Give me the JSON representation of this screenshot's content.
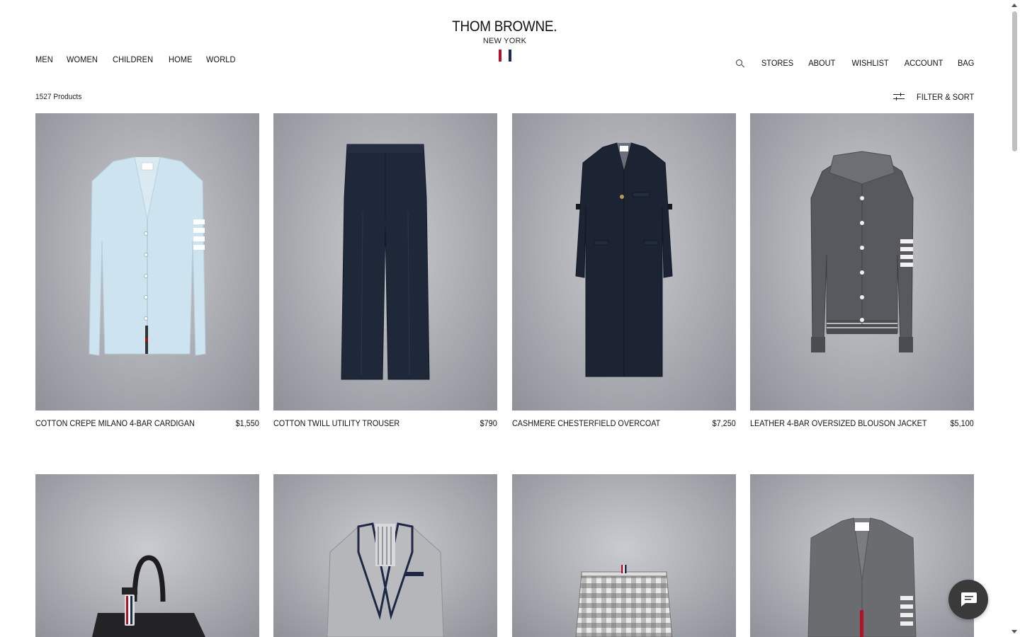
{
  "header": {
    "brand": "THOM BROWNE.",
    "city": "NEW YORK",
    "flag_colors": [
      "#b0122a",
      "#ffffff",
      "#1d2a55"
    ]
  },
  "nav_left": [
    "MEN",
    "WOMEN",
    "CHILDREN",
    "HOME",
    "WORLD"
  ],
  "nav_right": [
    "STORES",
    "ABOUT",
    "WISHLIST",
    "ACCOUNT",
    "BAG"
  ],
  "toolbar": {
    "product_count": "1527 Products",
    "filter_label": "FILTER & SORT"
  },
  "products": [
    {
      "name": "COTTON CREPE MILANO 4-BAR CARDIGAN",
      "price": "$1,550",
      "icon": "cardigan-light-blue"
    },
    {
      "name": "COTTON TWILL UTILITY TROUSER",
      "price": "$790",
      "icon": "trouser-navy"
    },
    {
      "name": "CASHMERE CHESTERFIELD OVERCOAT",
      "price": "$7,250",
      "icon": "overcoat-navy"
    },
    {
      "name": "LEATHER 4-BAR OVERSIZED BLOUSON JACKET",
      "price": "$5,100",
      "icon": "blouson-grey"
    }
  ],
  "products_row2": [
    {
      "icon": "backpack-black"
    },
    {
      "icon": "blazer-grey"
    },
    {
      "icon": "skirt-check"
    },
    {
      "icon": "cardigan-grey"
    }
  ],
  "colors": {
    "text": "#111111",
    "chat_button": "#3a3a3a"
  }
}
